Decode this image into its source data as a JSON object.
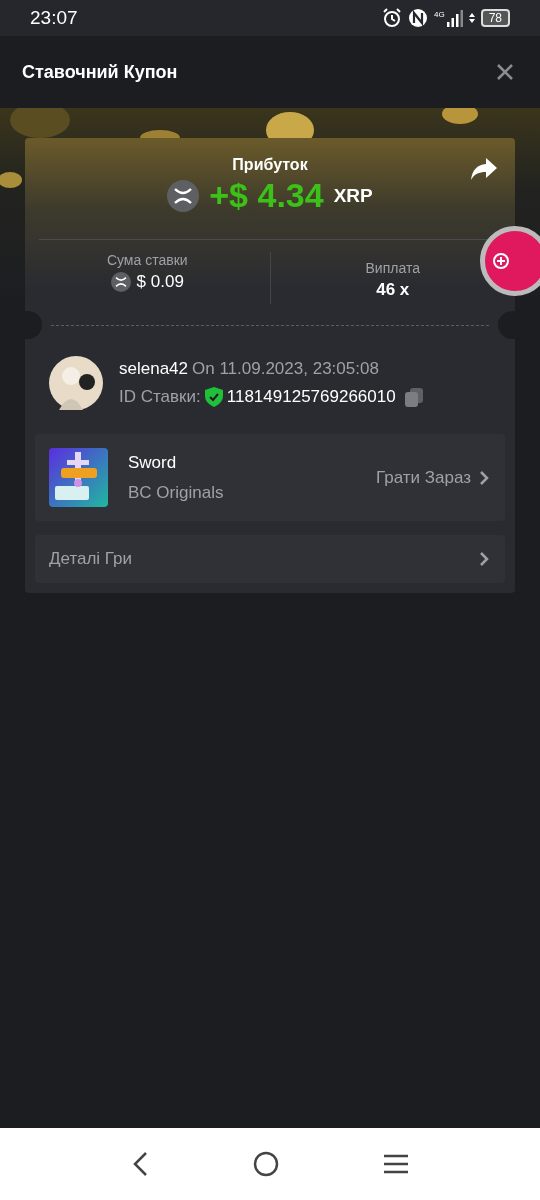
{
  "status_bar": {
    "time": "23:07",
    "network": "4G",
    "battery": "78"
  },
  "header": {
    "title": "Ставочний Купон"
  },
  "profit": {
    "label": "Прибуток",
    "amount": "+$ 4.34",
    "currency": "XRP"
  },
  "stats": [
    {
      "label": "Сума ставки",
      "value": "$ 0.09",
      "coin": true
    },
    {
      "label": "Виплата",
      "value": "46 x",
      "coin": false
    }
  ],
  "bet": {
    "user": "selena42",
    "date": "On 11.09.2023, 23:05:08",
    "id_label": "ID Ставки:",
    "id": "118149125769266010"
  },
  "game": {
    "name": "Sword",
    "provider": "BC Originals",
    "action": "Грати Зараз"
  },
  "details": {
    "label": "Деталі Гри"
  }
}
